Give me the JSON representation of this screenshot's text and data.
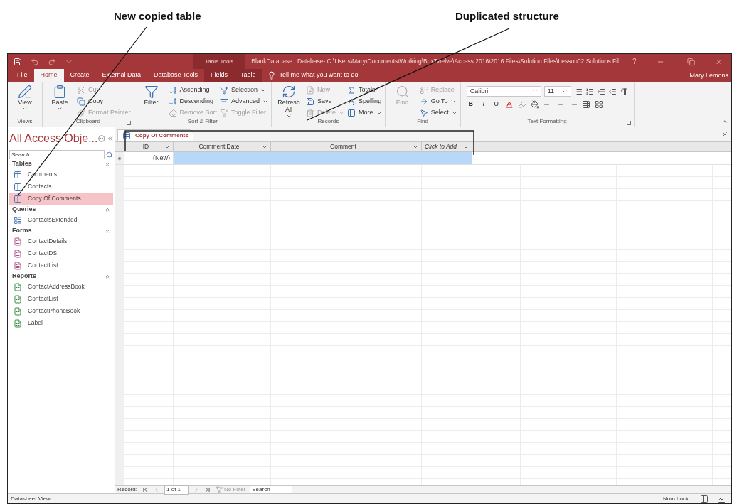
{
  "annotations": [
    {
      "text": "New copied table"
    },
    {
      "text": "Duplicated structure"
    }
  ],
  "window": {
    "contextual_group": "Table Tools",
    "title": "BlankDatabase : Database- C:\\Users\\Mary\\Documents\\Working\\BoxTwelve\\Access 2016\\2016 Files\\Solution Files\\Lesson02 Solutions Fil...",
    "help": "?",
    "user": "Mary Lemons"
  },
  "tabs": [
    {
      "label": "File",
      "selected": false,
      "contextual": false
    },
    {
      "label": "Home",
      "selected": true,
      "contextual": false
    },
    {
      "label": "Create",
      "selected": false,
      "contextual": false
    },
    {
      "label": "External Data",
      "selected": false,
      "contextual": false
    },
    {
      "label": "Database Tools",
      "selected": false,
      "contextual": false
    },
    {
      "label": "Fields",
      "selected": false,
      "contextual": true
    },
    {
      "label": "Table",
      "selected": false,
      "contextual": true
    }
  ],
  "tell_me": "Tell me what you want to do",
  "ribbon_groups": [
    {
      "label": "Views",
      "launcher": false,
      "items": [
        {
          "kind": "large",
          "label": "View",
          "disabled": false,
          "menu": true
        }
      ]
    },
    {
      "label": "Clipboard",
      "launcher": true,
      "items": [
        {
          "kind": "large",
          "label": "Paste",
          "disabled": false,
          "menu": true
        },
        {
          "kind": "small",
          "label": "Cut",
          "disabled": true,
          "menu": false
        },
        {
          "kind": "small",
          "label": "Copy",
          "disabled": false,
          "menu": false
        },
        {
          "kind": "small",
          "label": "Format Painter",
          "disabled": true,
          "menu": false
        }
      ]
    },
    {
      "label": "Sort & Filter",
      "launcher": false,
      "items": [
        {
          "kind": "large",
          "label": "Filter",
          "disabled": false,
          "menu": false
        },
        {
          "kind": "small",
          "label": "Ascending",
          "disabled": false,
          "menu": false
        },
        {
          "kind": "small",
          "label": "Descending",
          "disabled": false,
          "menu": false
        },
        {
          "kind": "small",
          "label": "Remove Sort",
          "disabled": true,
          "menu": false
        },
        {
          "kind": "small",
          "label": "Selection",
          "disabled": false,
          "menu": true
        },
        {
          "kind": "small",
          "label": "Advanced",
          "disabled": false,
          "menu": true
        },
        {
          "kind": "small",
          "label": "Toggle Filter",
          "disabled": true,
          "menu": false
        }
      ]
    },
    {
      "label": "Records",
      "launcher": false,
      "items": [
        {
          "kind": "large",
          "label": "Refresh All",
          "disabled": false,
          "menu": true
        },
        {
          "kind": "small",
          "label": "New",
          "disabled": true,
          "menu": false
        },
        {
          "kind": "small",
          "label": "Save",
          "disabled": false,
          "menu": false
        },
        {
          "kind": "small",
          "label": "Delete",
          "disabled": true,
          "menu": true
        },
        {
          "kind": "small",
          "label": "Totals",
          "disabled": false,
          "menu": false
        },
        {
          "kind": "small",
          "label": "Spelling",
          "disabled": false,
          "menu": false
        },
        {
          "kind": "small",
          "label": "More",
          "disabled": false,
          "menu": true
        }
      ]
    },
    {
      "label": "Find",
      "launcher": false,
      "items": [
        {
          "kind": "large",
          "label": "Find",
          "disabled": true,
          "menu": false
        },
        {
          "kind": "small",
          "label": "Replace",
          "disabled": true,
          "menu": false
        },
        {
          "kind": "small",
          "label": "Go To",
          "disabled": false,
          "menu": true
        },
        {
          "kind": "small",
          "label": "Select",
          "disabled": false,
          "menu": true
        }
      ]
    },
    {
      "label": "Text Formatting",
      "launcher": true,
      "items": [
        {
          "kind": "font",
          "font": "Calibri",
          "size": "11",
          "bold": "B",
          "italic": "I",
          "underline": "U"
        }
      ]
    }
  ],
  "nav_pane": {
    "title": "All Access Obje...",
    "search_placeholder": "Search...",
    "groups": [
      {
        "label": "Tables",
        "kind": "table",
        "expanded": true,
        "items": [
          {
            "label": "Comments",
            "selected": false
          },
          {
            "label": "Contacts",
            "selected": false
          },
          {
            "label": "Copy Of Comments",
            "selected": true
          }
        ]
      },
      {
        "label": "Queries",
        "kind": "query",
        "expanded": true,
        "items": [
          {
            "label": "ContactsExtended",
            "selected": false
          }
        ]
      },
      {
        "label": "Forms",
        "kind": "form",
        "expanded": true,
        "items": [
          {
            "label": "ContactDetails",
            "selected": false
          },
          {
            "label": "ContactDS",
            "selected": false
          },
          {
            "label": "ContactList",
            "selected": false
          }
        ]
      },
      {
        "label": "Reports",
        "kind": "report",
        "expanded": true,
        "items": [
          {
            "label": "ContactAddressBook",
            "selected": false
          },
          {
            "label": "ContactList",
            "selected": false
          },
          {
            "label": "ContactPhoneBook",
            "selected": false
          },
          {
            "label": "Label",
            "selected": false
          }
        ]
      }
    ]
  },
  "document_tab": {
    "label": "Copy Of Comments",
    "selected": true
  },
  "datasheet": {
    "columns": [
      {
        "label": "ID",
        "kind": "field"
      },
      {
        "label": "Comment Date",
        "kind": "field"
      },
      {
        "label": "Comment",
        "kind": "field"
      },
      {
        "label": "Click to Add",
        "kind": "add"
      }
    ],
    "new_row": {
      "id": "(New)",
      "selected": true
    }
  },
  "record_nav": {
    "label": "Record:",
    "position": "1 of 1",
    "filter": "No Filter",
    "search_placeholder": "Search"
  },
  "status_bar": {
    "view": "Datasheet View",
    "num_lock": "Num Lock"
  }
}
